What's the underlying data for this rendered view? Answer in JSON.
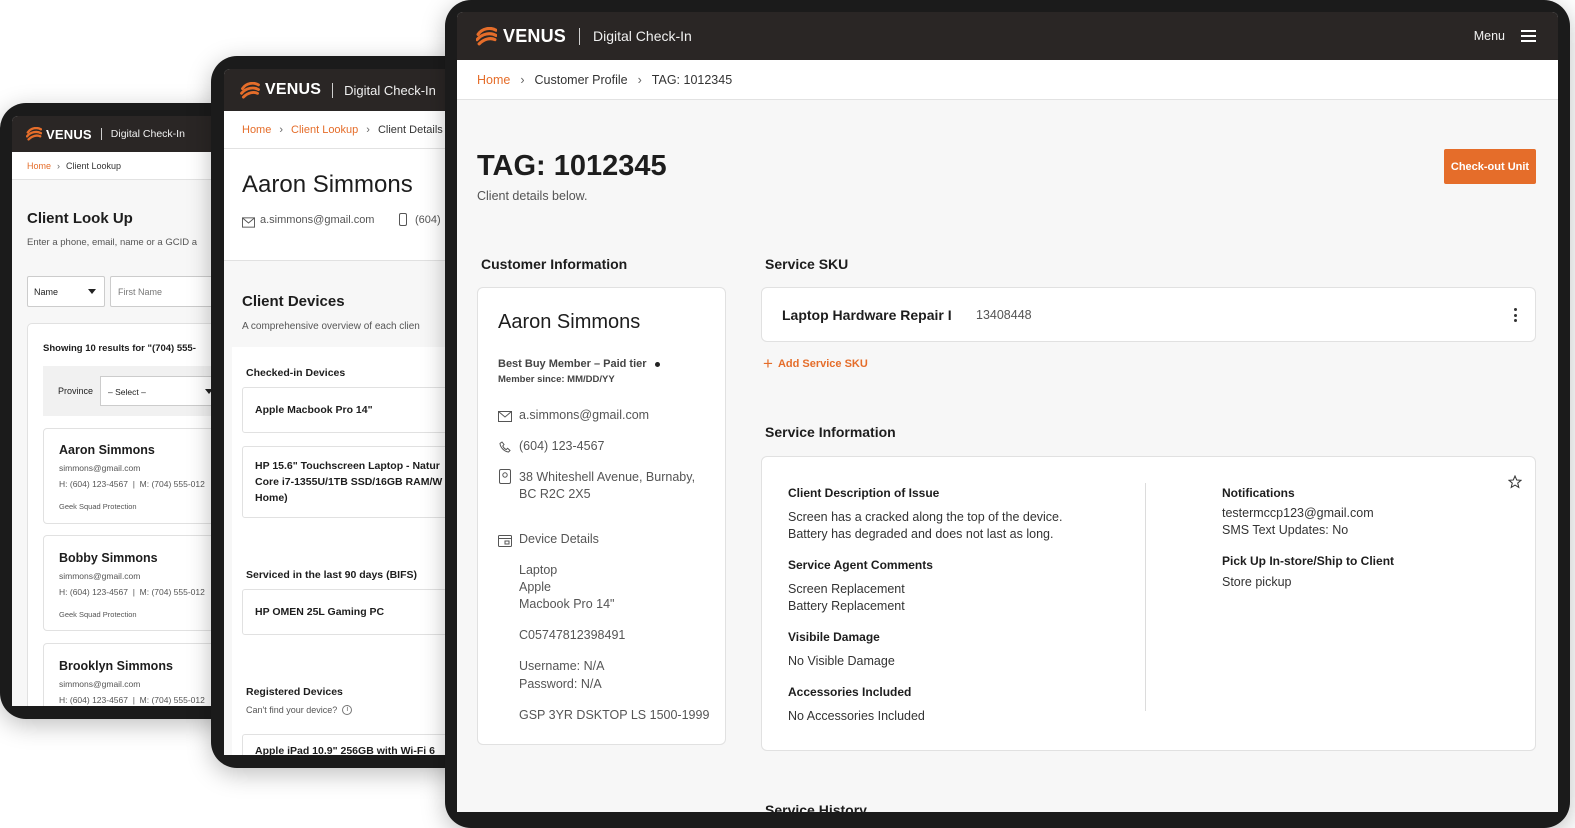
{
  "brand": {
    "name": "VENUS",
    "app": "Digital Check-In",
    "menu": "Menu",
    "accent": "#e56d2a",
    "bar": "#2a2625"
  },
  "screen1": {
    "crumbs": {
      "home": "Home",
      "current": "Client Lookup"
    },
    "title": "Client Look Up",
    "subtitle": "Enter a phone, email, name or a GCID a",
    "search_type": "Name",
    "first_name_placeholder": "First Name",
    "results_text": "Showing 10 results for \"(704) 555-",
    "province_label": "Province",
    "province_select": "– Select –",
    "clients": [
      {
        "name": "Aaron Simmons",
        "email": "simmons@gmail.com",
        "phones": "H: (604) 123-4567  |  M: (704) 555-012",
        "tag": "Geek Squad Protection"
      },
      {
        "name": "Bobby Simmons",
        "email": "simmons@gmail.com",
        "phones": "H: (604) 123-4567  |  M: (704) 555-012",
        "tag": "Geek Squad Protection"
      },
      {
        "name": "Brooklyn Simmons",
        "email": "simmons@gmail.com",
        "phones": "H: (604) 123-4567  |  M: (704) 555-012",
        "tag": ""
      }
    ]
  },
  "screen2": {
    "crumbs": {
      "home": "Home",
      "lookup": "Client Lookup",
      "current": "Client Details"
    },
    "name": "Aaron Simmons",
    "email": "a.simmons@gmail.com",
    "phone": "(604)",
    "devices_title": "Client Devices",
    "devices_sub": "A comprehensive overview of each clien",
    "checked_in_label": "Checked-in Devices",
    "checked_in": [
      {
        "line1": "Apple Macbook Pro 14\"",
        "line2": "",
        "line3": ""
      },
      {
        "line1": "HP 15.6\" Touchscreen Laptop - Natur",
        "line2": "Core i7-1355U/1TB SSD/16GB RAM/W",
        "line3": "Home)"
      }
    ],
    "serviced_label": "Serviced in the last 90 days (BIFS)",
    "serviced": [
      "HP OMEN 25L Gaming PC"
    ],
    "registered_label": "Registered Devices",
    "cant_find": "Can't find your device?",
    "registered_peek": "Apple iPad 10.9\" 256GB with Wi-Fi 6"
  },
  "screen3": {
    "crumbs": {
      "home": "Home",
      "profile": "Customer Profile",
      "current": "TAG: 1012345"
    },
    "title": "TAG: 1012345",
    "subtitle": "Client details below.",
    "checkout_button": "Check-out Unit",
    "customer_heading": "Customer Information",
    "customer": {
      "name": "Aaron Simmons",
      "membership": "Best Buy Member – Paid tier",
      "member_since": "Member since: MM/DD/YY",
      "email": "a.simmons@gmail.com",
      "phone": "(604) 123-4567",
      "address_line1": "38 Whiteshell Avenue, Burnaby,",
      "address_line2": "BC R2C 2X5",
      "device_details_label": "Device Details",
      "device_type": "Laptop",
      "device_brand": "Apple",
      "device_model": "Macbook Pro 14\"",
      "serial": "C05747812398491",
      "username": "Username: N/A",
      "password": "Password: N/A",
      "plan": "GSP 3YR DSKTOP LS 1500-1999"
    },
    "sku_heading": "Service SKU",
    "sku": {
      "name": "Laptop Hardware Repair I",
      "code": "13408448"
    },
    "add_sku": "Add Service SKU",
    "service_heading": "Service Information",
    "service": {
      "issue_label": "Client Description of Issue",
      "issue_line1": "Screen has a cracked along the top of the device.",
      "issue_line2": "Battery has degraded and does not last as long.",
      "agent_label": "Service Agent Comments",
      "agent_line1": "Screen Replacement",
      "agent_line2": "Battery Replacement",
      "damage_label": "Visibile Damage",
      "damage_value": "No Visible Damage",
      "accessories_label": "Accessories Included",
      "accessories_value": "No Accessories Included",
      "notifications_label": "Notifications",
      "notif_email": "testermccp123@gmail.com",
      "notif_sms": "SMS Text Updates: No",
      "pickup_label": "Pick Up In-store/Ship to Client",
      "pickup_value": "Store pickup"
    },
    "history_heading": "Service History"
  },
  "icons": [
    "venus-logo-icon",
    "hamburger-menu-icon",
    "chevron-right-icon",
    "chevron-down-icon",
    "envelope-icon",
    "phone-icon",
    "location-pin-icon",
    "device-card-icon",
    "mobile-phone-icon",
    "plus-icon",
    "kebab-menu-icon",
    "star-icon",
    "info-icon"
  ]
}
